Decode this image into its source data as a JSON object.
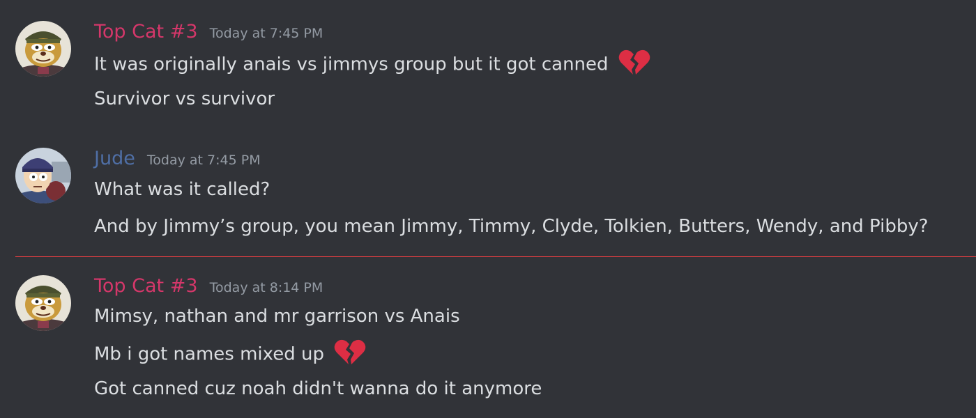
{
  "colors": {
    "background": "#313338",
    "message_text": "#dbdee1",
    "timestamp": "#949ba4",
    "new_divider": "#f23f42"
  },
  "messages": [
    {
      "username": "Top Cat #3",
      "username_color": "#d5376a",
      "timestamp": "Today at 7:45 PM",
      "avatar_icon": "top-cat-avatar",
      "lines": [
        {
          "text": "It was originally anais vs jimmys group but it got canned",
          "emoji": "broken-heart"
        },
        {
          "text": "Survivor vs survivor"
        }
      ]
    },
    {
      "username": "Jude",
      "username_color": "#4f6fa6",
      "timestamp": "Today at 7:45 PM",
      "avatar_icon": "jude-avatar",
      "lines": [
        {
          "text": "What was it called?"
        },
        {
          "text": "And by Jimmy’s group, you mean Jimmy, Timmy, Clyde, Tolkien, Butters, Wendy, and Pibby?"
        }
      ]
    },
    {
      "username": "Top Cat #3",
      "username_color": "#d5376a",
      "timestamp": "Today at 8:14 PM",
      "avatar_icon": "top-cat-avatar",
      "lines": [
        {
          "text": "Mimsy, nathan and mr garrison vs Anais"
        },
        {
          "text": "Mb i got names mixed up",
          "emoji": "broken-heart"
        },
        {
          "text": "Got canned cuz noah didn't wanna do it anymore"
        }
      ]
    }
  ]
}
